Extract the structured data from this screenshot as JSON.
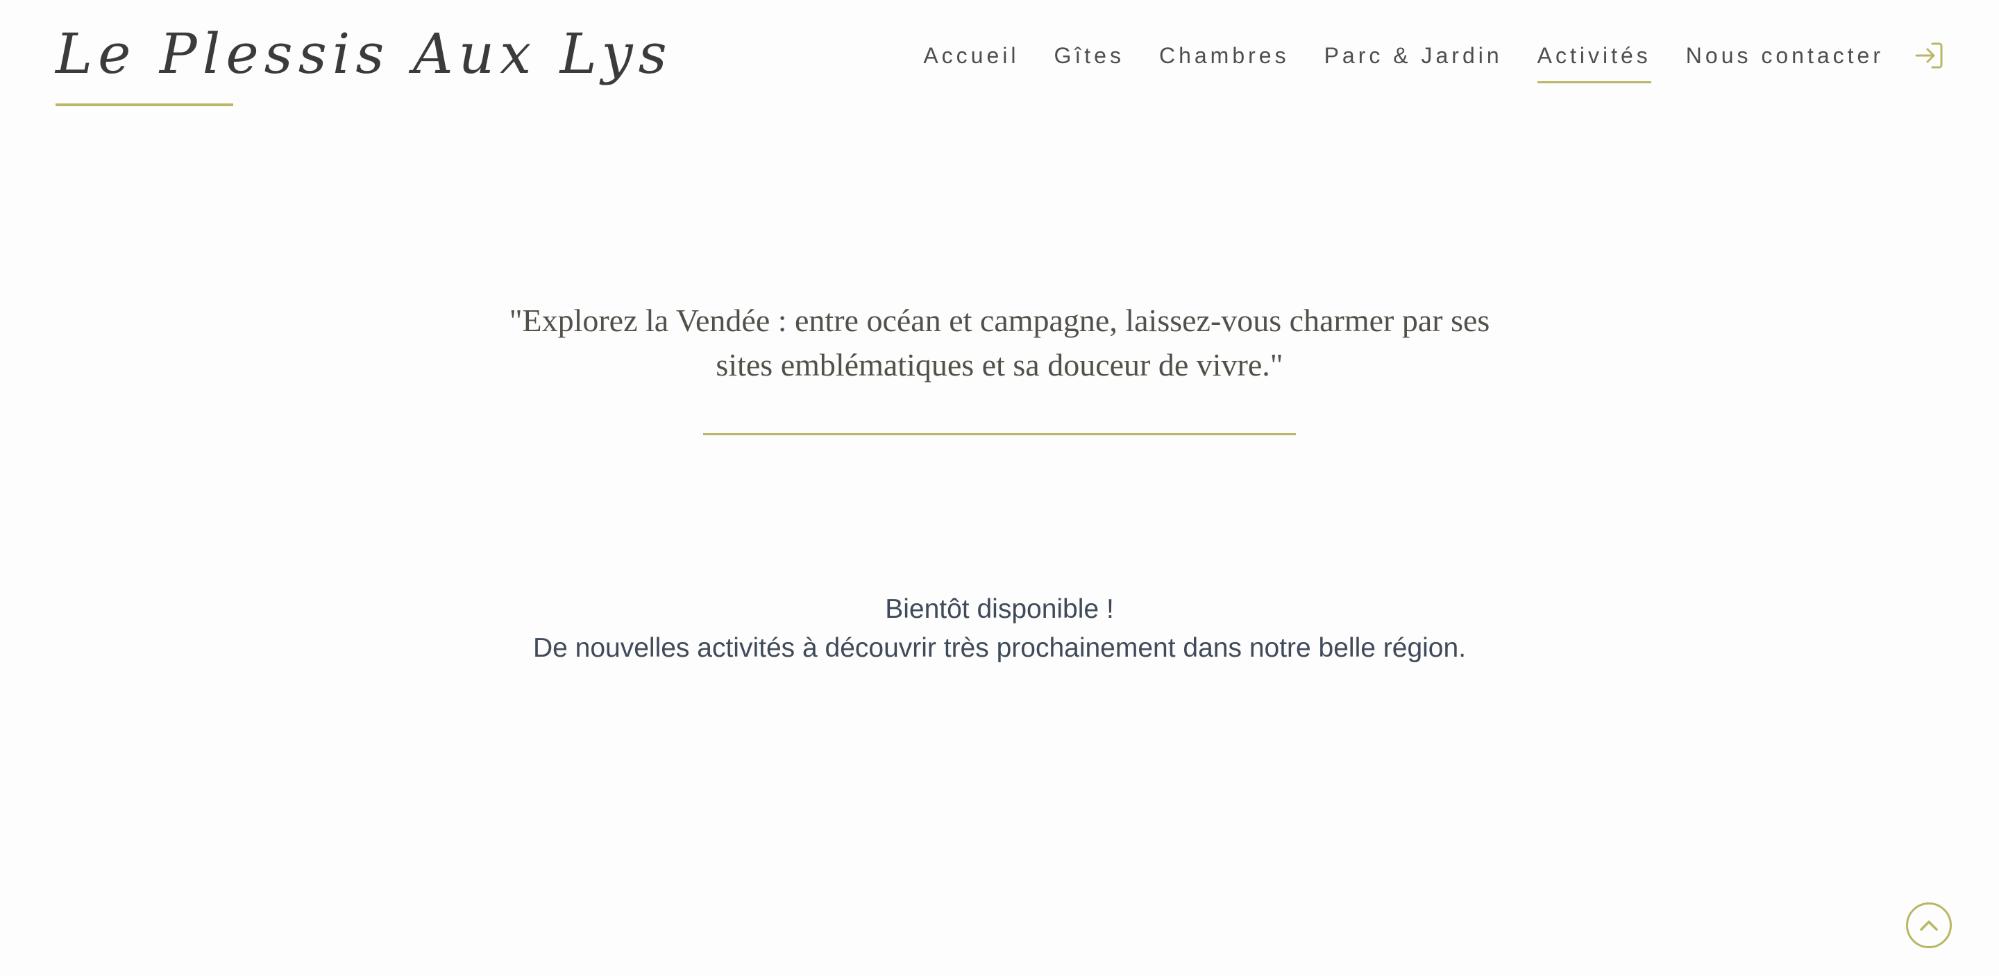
{
  "header": {
    "logo_text": "Le Plessis Aux Lys",
    "nav": {
      "items": [
        {
          "label": "Accueil"
        },
        {
          "label": "Gîtes"
        },
        {
          "label": "Chambres"
        },
        {
          "label": "Parc & Jardin"
        },
        {
          "label": "Activités",
          "active": true
        },
        {
          "label": "Nous contacter"
        }
      ]
    },
    "login_icon": "login-arrow-icon"
  },
  "main": {
    "quote_line1": "\"Explorez la Vendée : entre océan et campagne, laissez-vous charmer par ses",
    "quote_line2": "sites emblématiques et sa douceur de vivre.\"",
    "soon_title": "Bientôt disponible !",
    "soon_text": "De nouvelles activités à découvrir très prochainement dans notre belle région."
  },
  "scroll_top_icon": "chevron-up-icon",
  "colors": {
    "accent": "#b9b764",
    "text_dark": "#3b3b3b",
    "text_body": "#3f4a5a",
    "background": "#fdfdfd"
  }
}
